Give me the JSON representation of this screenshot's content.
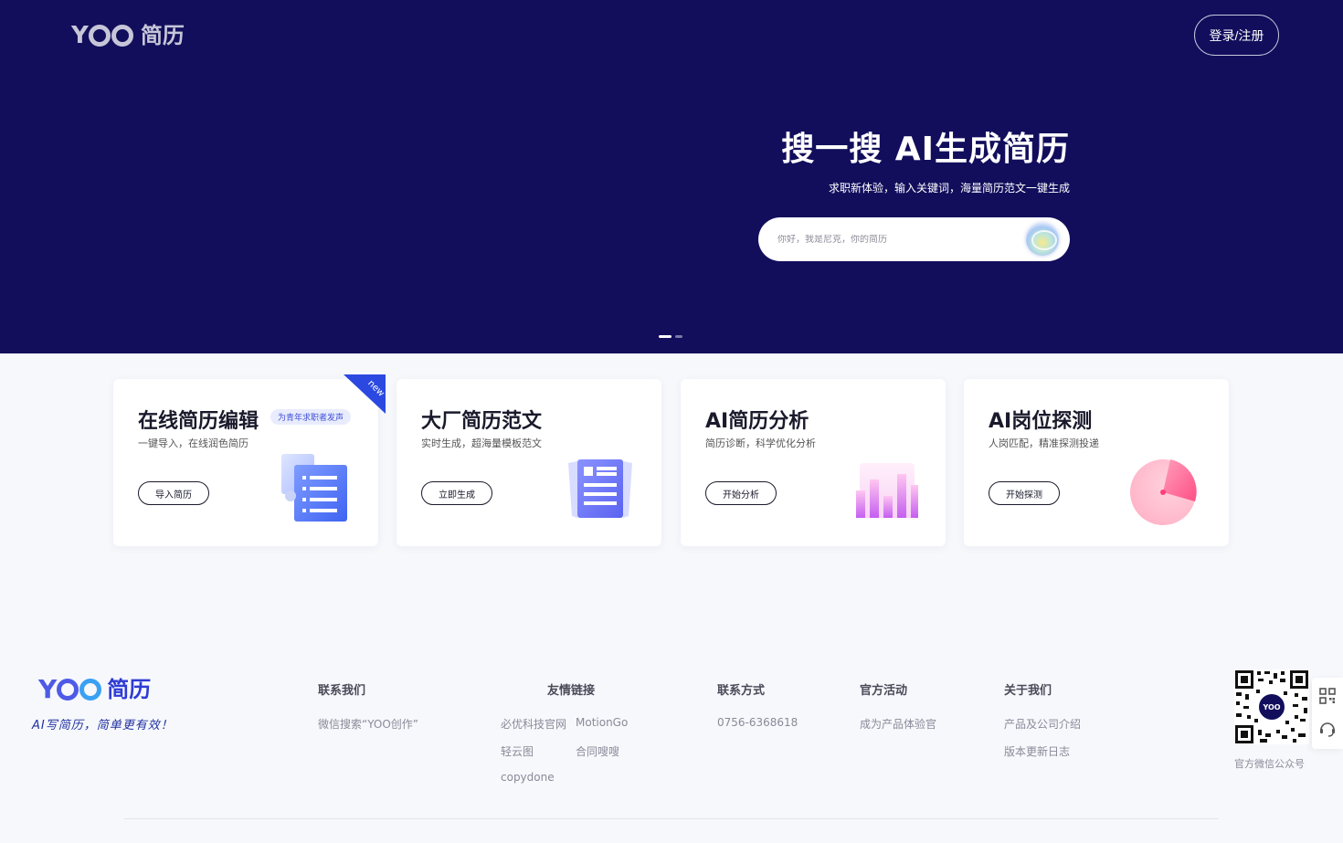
{
  "header": {
    "logo_mark_y": "Y",
    "logo_text": "简历",
    "login_label": "登录/注册"
  },
  "hero": {
    "title": "搜一搜 AI生成简历",
    "subtitle": "求职新体验，输入关键词，海量简历范文一键生成",
    "search_placeholder": "你好，我是尼克，你的简历"
  },
  "cards": [
    {
      "title": "在线简历编辑",
      "tag": "为青年求职者发声",
      "ribbon": "new",
      "desc": "一键导入，在线润色简历",
      "button": "导入简历"
    },
    {
      "title": "大厂简历范文",
      "desc": "实时生成，超海量模板范文",
      "button": "立即生成"
    },
    {
      "title": "AI简历分析",
      "desc": "简历诊断，科学优化分析",
      "button": "开始分析"
    },
    {
      "title": "AI岗位探测",
      "desc": "人岗匹配，精准探测投递",
      "button": "开始探测"
    }
  ],
  "footer": {
    "logo_mark_y": "Y",
    "logo_text": "简历",
    "slogan": "AI写简历，简单更有效！",
    "contact": {
      "title": "联系我们",
      "items": [
        "微信搜索“YOO创作”"
      ]
    },
    "friends": {
      "title": "友情链接",
      "items": [
        "必优科技官网",
        "MotionGo",
        "轻云图",
        "合同嗖嗖",
        "copydone"
      ]
    },
    "phone": {
      "title": "联系方式",
      "items": [
        "0756-6368618"
      ]
    },
    "events": {
      "title": "官方活动",
      "items": [
        "成为产品体验官"
      ]
    },
    "about": {
      "title": "关于我们",
      "items": [
        "产品及公司介绍",
        "版本更新日志"
      ]
    },
    "qr_caption": "官方微信公众号",
    "qr_center_text": "YOO"
  },
  "colors": {
    "hero_bg": "#120e5c",
    "accent": "#2b49e0",
    "brand": "#4d5be6"
  }
}
